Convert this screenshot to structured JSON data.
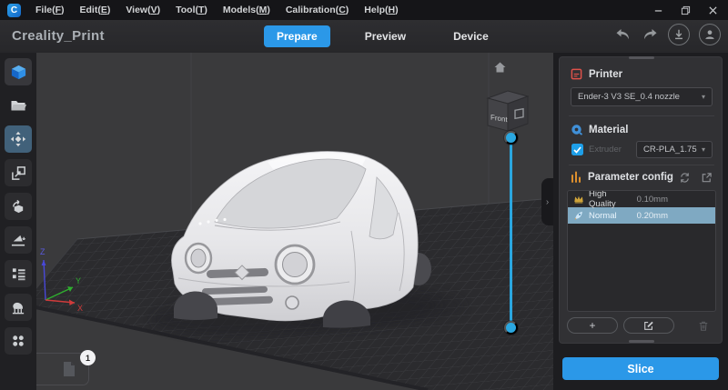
{
  "menu_bar": {
    "items": [
      {
        "id": "file",
        "label": "File(F)"
      },
      {
        "id": "edit",
        "label": "Edit(E)"
      },
      {
        "id": "view",
        "label": "View(V)"
      },
      {
        "id": "tool",
        "label": "Tool(T)"
      },
      {
        "id": "models",
        "label": "Models(M)"
      },
      {
        "id": "calibration",
        "label": "Calibration(C)"
      },
      {
        "id": "help",
        "label": "Help(H)"
      }
    ]
  },
  "window_controls": [
    {
      "id": "minimize",
      "icon": "minimize-icon"
    },
    {
      "id": "maximize",
      "icon": "maximize-icon"
    },
    {
      "id": "close",
      "icon": "close-icon"
    }
  ],
  "header": {
    "app_title": "Creality_Print",
    "tabs": [
      {
        "id": "prepare",
        "label": "Prepare",
        "active": true
      },
      {
        "id": "preview",
        "label": "Preview",
        "active": false
      },
      {
        "id": "device",
        "label": "Device",
        "active": false
      }
    ],
    "actions": [
      {
        "id": "undo",
        "icon": "undo-icon",
        "ring": false
      },
      {
        "id": "redo",
        "icon": "redo-icon",
        "ring": false
      },
      {
        "id": "download",
        "icon": "download-icon",
        "ring": true
      },
      {
        "id": "account",
        "icon": "account-icon",
        "ring": true
      }
    ]
  },
  "toolbar_left": {
    "tools": [
      {
        "id": "add-model",
        "icon": "add-model-icon",
        "style": "primary",
        "active": false
      },
      {
        "id": "open-file",
        "icon": "open-file-icon",
        "style": "plain",
        "active": false
      },
      {
        "id": "move",
        "icon": "move-icon",
        "style": "tool",
        "active": true
      },
      {
        "id": "scale",
        "icon": "scale-icon",
        "style": "tool",
        "active": false
      },
      {
        "id": "rotate",
        "icon": "rotate-icon",
        "style": "tool",
        "active": false
      },
      {
        "id": "lay-flat",
        "icon": "lay-flat-icon",
        "style": "tool",
        "active": false
      },
      {
        "id": "object-list",
        "icon": "object-list-icon",
        "style": "tool",
        "active": false
      },
      {
        "id": "support",
        "icon": "support-icon",
        "style": "tool",
        "active": false
      },
      {
        "id": "more-tools",
        "icon": "more-tools-icon",
        "style": "tool",
        "active": false
      }
    ]
  },
  "viewport": {
    "nav_cube_label": "Front",
    "axes": {
      "x": "X",
      "y": "Y",
      "z": "Z"
    },
    "plate_count_badge": "1"
  },
  "right_panel": {
    "printer": {
      "label": "Printer",
      "selected": "Ender-3 V3 SE_0.4 nozzle"
    },
    "material": {
      "label": "Material",
      "extruder_label": "Extruder",
      "extruder_checked": true,
      "selected": "CR-PLA_1.75"
    },
    "parameter_config": {
      "label": "Parameter config",
      "profiles": [
        {
          "icon": "crown-icon",
          "name": "High Quality",
          "value": "0.10mm",
          "selected": false
        },
        {
          "icon": "rocket-icon",
          "name": "Normal",
          "value": "0.20mm",
          "selected": true
        }
      ],
      "add_label": "+"
    },
    "slice_label": "Slice"
  },
  "colors": {
    "accent": "#2b98e8",
    "slider": "#2ba7e0",
    "selected_profile_bg": "#7fa9c2",
    "checkbox": "#1e9fe8",
    "printer_icon": "#e0524a",
    "material_icon": "#4090d8",
    "parameter_icon": "#dd8f2d",
    "crown_icon": "#cfa43a",
    "axis_x": "#d03b3b",
    "axis_y": "#2fae2f",
    "axis_z": "#4848d8"
  }
}
